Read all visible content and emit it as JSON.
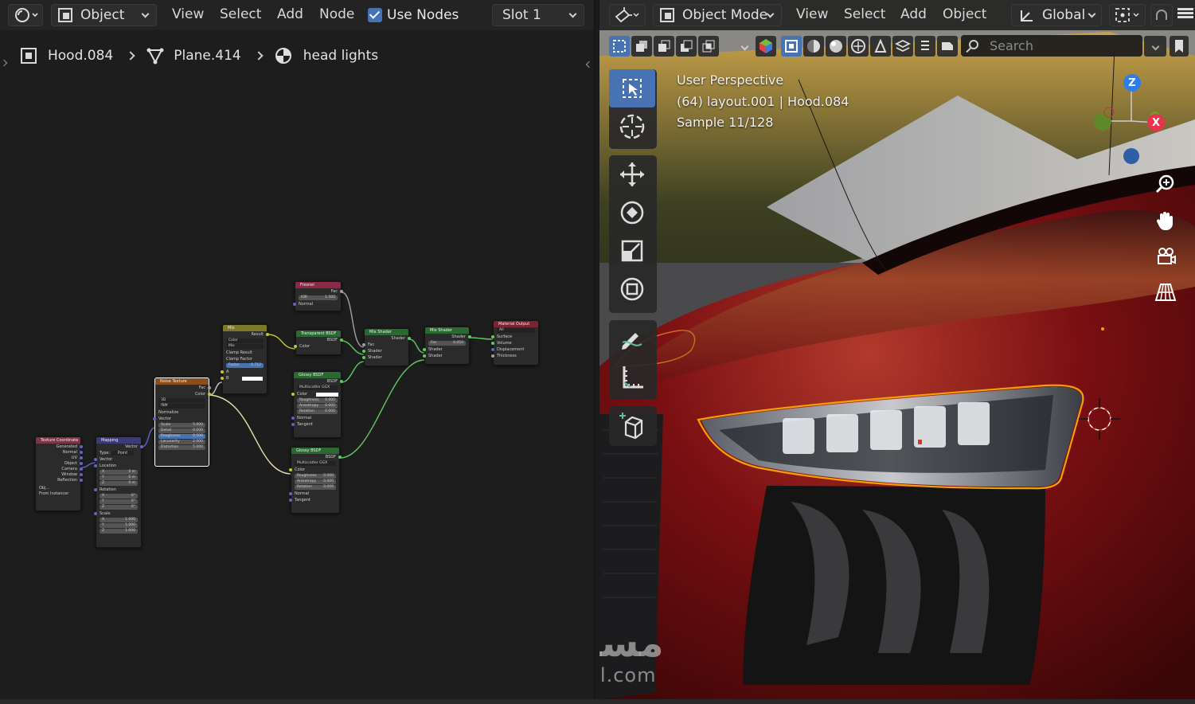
{
  "node_editor": {
    "header": {
      "editor_type_icon": "shader-editor-icon",
      "object_dropdown": "Object",
      "menus": [
        "View",
        "Select",
        "Add",
        "Node"
      ],
      "use_nodes_label": "Use Nodes",
      "use_nodes_checked": true,
      "slot_dropdown": "Slot 1"
    },
    "breadcrumb": {
      "object": "Hood.084",
      "mesh": "Plane.414",
      "material": "head lights"
    },
    "nodes": {
      "texcoord": {
        "title": "Texture Coordinate",
        "outputs": [
          "Generated",
          "Normal",
          "UV",
          "Object",
          "Camera",
          "Window",
          "Reflection"
        ],
        "obj_label": "Obj...",
        "from_instancer": "From Instancer"
      },
      "mapping": {
        "title": "Mapping",
        "output": "Vector",
        "type_label": "Type:",
        "type_value": "Point",
        "vector": "Vector",
        "location": "Location",
        "loc": [
          [
            "X",
            "0 m"
          ],
          [
            "Y",
            "0 m"
          ],
          [
            "Z",
            "0 m"
          ]
        ],
        "rotation": "Rotation",
        "rot": [
          [
            "X",
            "0°"
          ],
          [
            "Y",
            "0°"
          ],
          [
            "Z",
            "0°"
          ]
        ],
        "scale": "Scale",
        "scl": [
          [
            "X",
            "1.000"
          ],
          [
            "Y",
            "1.000"
          ],
          [
            "Z",
            "1.000"
          ]
        ]
      },
      "noise": {
        "title": "Noise Texture",
        "outputs": [
          "Fac",
          "Color"
        ],
        "dim": "3D",
        "type": "fBM",
        "normalize": "Normalize",
        "vector": "Vector",
        "fields": [
          [
            "Scale",
            "5.000"
          ],
          [
            "Detail",
            "0.000"
          ],
          [
            "Roughness",
            "0.500"
          ],
          [
            "Lacunarity",
            "2.000"
          ],
          [
            "Distortion",
            "5.000"
          ]
        ]
      },
      "mix": {
        "title": "Mix",
        "output": "Result",
        "data_type": "Color",
        "blend": "Mix",
        "clamp_result": "Clamp Result",
        "clamp_factor": "Clamp Factor",
        "factor_label": "Factor",
        "factor_value": "0.712",
        "a": "A",
        "b": "B"
      },
      "fresnel": {
        "title": "Fresnel",
        "output": "Fac",
        "ior_label": "IOR",
        "ior_value": "1.500",
        "normal": "Normal"
      },
      "transparent": {
        "title": "Transparent BSDF",
        "output": "BSDF",
        "color": "Color"
      },
      "glossy1": {
        "title": "Glossy BSDF",
        "output": "BSDF",
        "dist": "Multiscatter GGX",
        "color": "Color",
        "fields": [
          [
            "Roughness",
            "0.000"
          ],
          [
            "Anisotropy",
            "0.000"
          ],
          [
            "Rotation",
            "0.000"
          ]
        ],
        "normal": "Normal",
        "tangent": "Tangent"
      },
      "glossy2": {
        "title": "Glossy BSDF",
        "output": "BSDF",
        "dist": "Multiscatter GGX",
        "color": "Color",
        "fields": [
          [
            "Roughness",
            "0.000"
          ],
          [
            "Anisotropy",
            "0.000"
          ],
          [
            "Rotation",
            "0.000"
          ]
        ],
        "normal": "Normal",
        "tangent": "Tangent"
      },
      "mixshader1": {
        "title": "Mix Shader",
        "output": "Shader",
        "fac": "Fac",
        "shader_a": "Shader",
        "shader_b": "Shader"
      },
      "mixshader2": {
        "title": "Mix Shader",
        "output": "Shader",
        "fac_label": "Fac",
        "fac_value": "0.050",
        "shader_a": "Shader",
        "shader_b": "Shader"
      },
      "output": {
        "title": "Material Output",
        "target": "All",
        "inputs": [
          "Surface",
          "Volume",
          "Displacement",
          "Thickness"
        ]
      }
    }
  },
  "viewport": {
    "header": {
      "editor_type_icon": "3d-viewport-icon",
      "mode_dropdown": "Object Mode",
      "menus": [
        "View",
        "Select",
        "Add",
        "Object"
      ],
      "orientation": "Global"
    },
    "search_placeholder": "Search",
    "overlay": {
      "line1": "User Perspective",
      "line2": "(64) layout.001 | Hood.084",
      "line3": "Sample 11/128"
    },
    "gizmo": {
      "z": "Z",
      "x": "X"
    },
    "colors": {
      "accent": "#4772b3",
      "selection": "#f5a000",
      "car_paint": "#7a0f12",
      "axis_x": "#e8344a",
      "axis_y": "#6ea52b",
      "axis_z": "#2d7ee8"
    }
  },
  "watermark": {
    "arabic": "مستقل",
    "latin": "mostaql.com"
  }
}
